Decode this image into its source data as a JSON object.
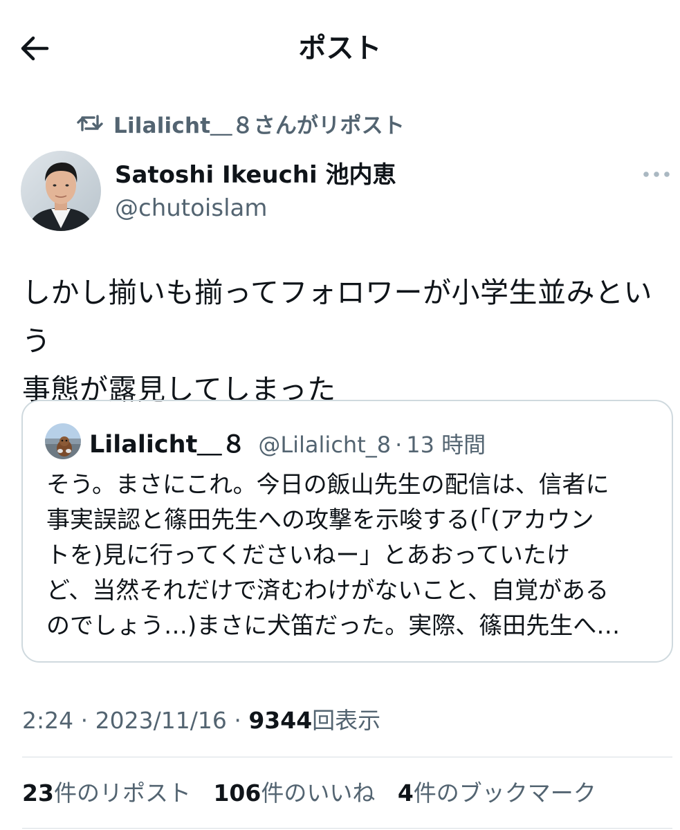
{
  "header": {
    "title": "ポスト",
    "back_icon": "arrow-left-icon"
  },
  "repost": {
    "text": "Lilalicht＿８さんがリポスト",
    "icon": "repost-icon"
  },
  "author": {
    "name": "Satoshi Ikeuchi 池内恵",
    "handle": "@chutoislam"
  },
  "tweet": {
    "lines": [
      "しかし揃いも揃ってフォロワーが小学生並みという",
      "事態が露見してしまった"
    ]
  },
  "quote": {
    "name": "Lilalicht＿８",
    "handle": "@Lilalicht_8",
    "separator": "·",
    "time": "13 時間",
    "lines": [
      "そう。まさにこれ。今日の飯山先生の配信は、信者に",
      "事実誤認と篠田先生への攻撃を示唆する(「(アカウン",
      "トを)見に行ってくださいねー」とあおっていたけ",
      "ど、当然それだけで済むわけがないこと、自覚がある",
      "のでしょう…)まさに犬笛だった。実際、篠田先生へ…"
    ]
  },
  "meta": {
    "time": "2:24",
    "sep1": "·",
    "date": "2023/11/16",
    "sep2": "·",
    "views_count": "9344",
    "views_label": "回表示"
  },
  "stats": {
    "reposts_count": "23",
    "reposts_label": "件のリポスト",
    "likes_count": "106",
    "likes_label": "件のいいね",
    "bookmarks_count": "4",
    "bookmarks_label": "件のブックマーク"
  },
  "colors": {
    "text": "#0f1419",
    "secondary": "#536471",
    "border": "#cfd9de",
    "more_dots": "#aab8c2"
  }
}
